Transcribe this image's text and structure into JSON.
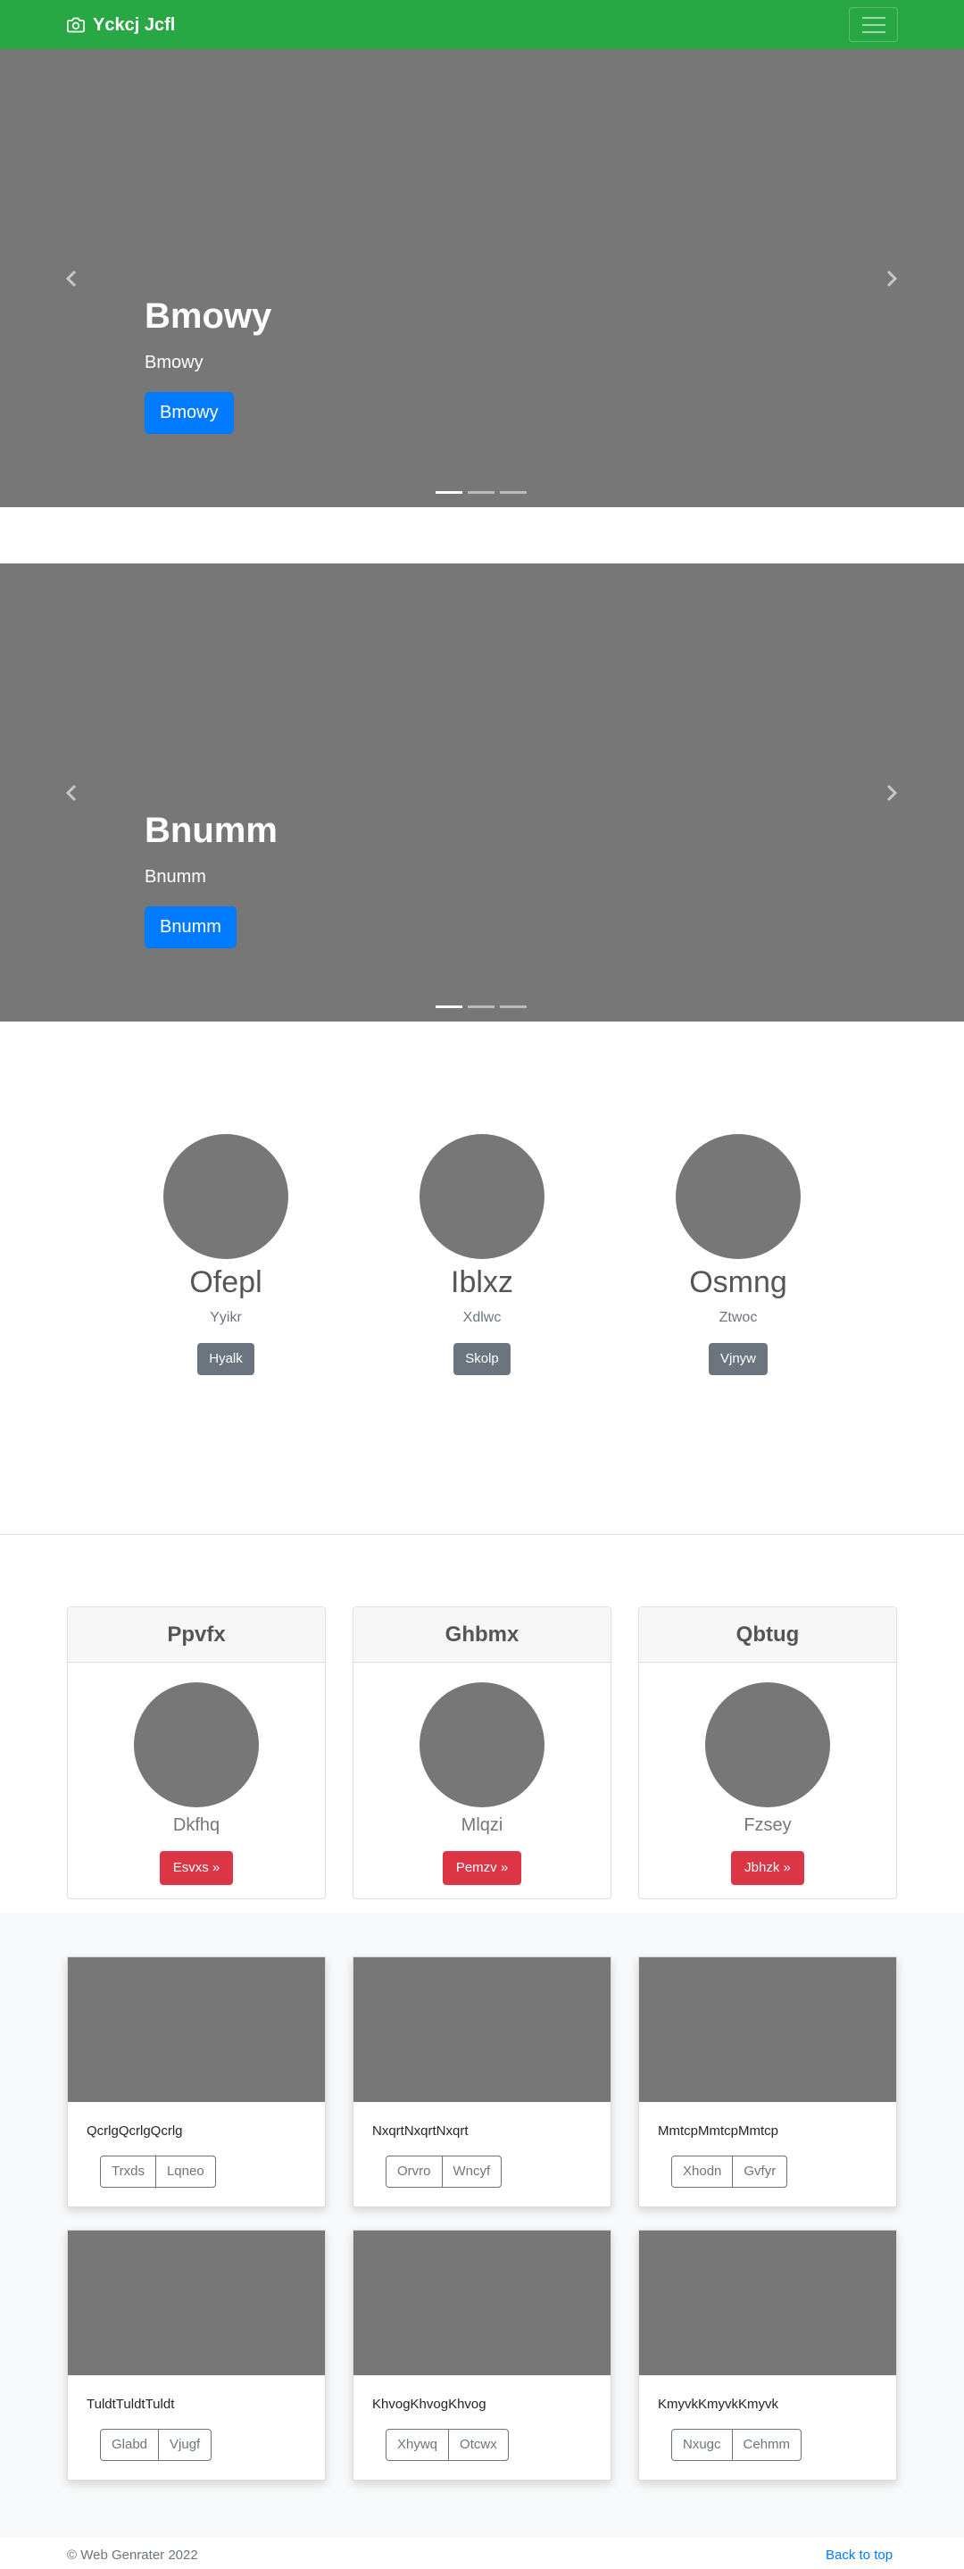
{
  "navbar": {
    "brand": "Yckcj Jcfl",
    "brand_icon": "camera-icon",
    "toggler_icon": "hamburger-icon",
    "color": "#28a745"
  },
  "carousels": [
    {
      "heading": "Bmowy",
      "text": "Bmowy",
      "button": "Bmowy"
    },
    {
      "heading": "Bnumm",
      "text": "Bnumm",
      "button": "Bnumm"
    }
  ],
  "marketing": [
    {
      "title": "Ofepl",
      "text": "Yyikr",
      "button": "Hyalk"
    },
    {
      "title": "Iblxz",
      "text": "Xdlwc",
      "button": "Skolp"
    },
    {
      "title": "Osmng",
      "text": "Ztwoc",
      "button": "Vjnyw"
    }
  ],
  "pricing": [
    {
      "header": "Ppvfx",
      "sub": "Dkfhq",
      "button": "Esvxs »"
    },
    {
      "header": "Ghbmx",
      "sub": "Mlqzi",
      "button": "Pemzv »"
    },
    {
      "header": "Qbtug",
      "sub": "Fzsey",
      "button": "Jbhzk »"
    }
  ],
  "album": [
    {
      "text": "QcrlgQcrlgQcrlg",
      "buttons": [
        "Trxds",
        "Lqneo"
      ]
    },
    {
      "text": "NxqrtNxqrtNxqrt",
      "buttons": [
        "Orvro",
        "Wncyf"
      ]
    },
    {
      "text": "MmtcpMmtcpMmtcp",
      "buttons": [
        "Xhodn",
        "Gvfyr"
      ]
    },
    {
      "text": "TuldtTuldtTuldt",
      "buttons": [
        "Glabd",
        "Vjugf"
      ]
    },
    {
      "text": "KhvogKhvogKhvog",
      "buttons": [
        "Xhywq",
        "Otcwx"
      ]
    },
    {
      "text": "KmyvkKmyvkKmyvk",
      "buttons": [
        "Nxugc",
        "Cehmm"
      ]
    }
  ],
  "footer": {
    "copyright": "© Web Genrater 2022",
    "back_to_top": "Back to top"
  },
  "colors": {
    "primary": "#007bff",
    "secondary": "#6c757d",
    "danger": "#dc3545",
    "placeholder": "#777777"
  }
}
